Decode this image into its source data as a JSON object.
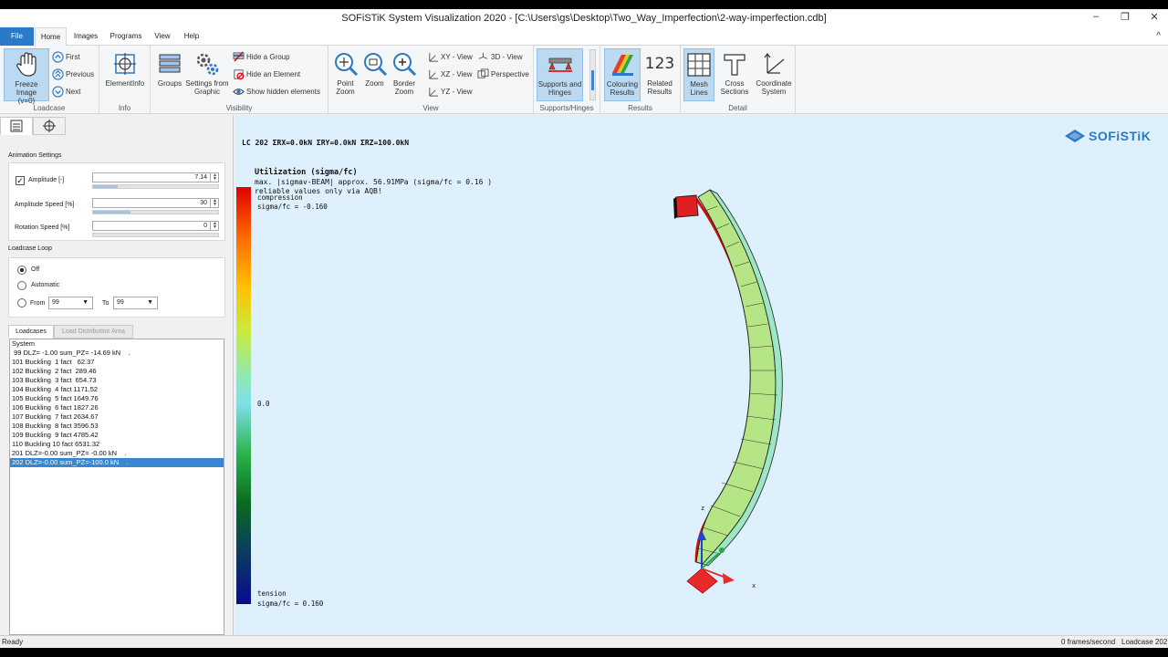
{
  "window": {
    "title": "SOFiSTiK System Visualization 2020 - [C:\\Users\\gs\\Desktop\\Two_Way_Imperfection\\2-way-imperfection.cdb]",
    "min": "–",
    "max": "❐",
    "close": "✕"
  },
  "menu": {
    "file": "File",
    "home": "Home",
    "images": "Images",
    "programs": "Programs",
    "view": "View",
    "help": "Help",
    "collapse": "^"
  },
  "ribbon": {
    "loadcase": {
      "label": "Loadcase",
      "freeze_line1": "Freeze Image",
      "freeze_line2": "(v=0)",
      "first": "First",
      "previous": "Previous",
      "next": "Next"
    },
    "info": {
      "label": "Info",
      "elementinfo": "ElementInfo"
    },
    "visibility": {
      "label": "Visibility",
      "groups": "Groups",
      "settings_line1": "Settings from",
      "settings_line2": "Graphic",
      "hide_group": "Hide a Group",
      "hide_element": "Hide an Element",
      "show_hidden": "Show hidden elements"
    },
    "view": {
      "label": "View",
      "point_zoom_1": "Point",
      "point_zoom_2": "Zoom",
      "zoom": "Zoom",
      "border_zoom_1": "Border",
      "border_zoom_2": "Zoom",
      "xy": "XY - View",
      "xz": "XZ - View",
      "yz": "YZ - View",
      "d3": "3D - View",
      "perspective": "Perspective"
    },
    "supports": {
      "label": "Supports/Hinges",
      "btn_1": "Supports and",
      "btn_2": "Hinges"
    },
    "results": {
      "label": "Results",
      "colouring_1": "Colouring",
      "colouring_2": "Results",
      "related_1": "Related",
      "related_2": "Results",
      "related_icon_text": "123"
    },
    "detail": {
      "label": "Detail",
      "mesh_1": "Mesh",
      "mesh_2": "Lines",
      "cross_1": "Cross",
      "cross_2": "Sections",
      "coord_1": "Coordinate",
      "coord_2": "System"
    }
  },
  "left_panel": {
    "animation_title": "Animation Settings",
    "amplitude_label": "Amplitude [-]",
    "amplitude_value": "7.14",
    "amplitude_fraction": 0.2,
    "amplitude_speed_label": "Amplitude Speed [%]",
    "amplitude_speed_value": "30",
    "amplitude_speed_fraction": 0.3,
    "rotation_speed_label": "Rotation Speed [%]",
    "rotation_speed_value": "0",
    "rotation_speed_fraction": 0,
    "loop_title": "Loadcase Loop",
    "off": "Off",
    "automatic": "Automatic",
    "from": "From",
    "from_value": "99",
    "to": "To",
    "to_value": "99",
    "tab_loadcases": "Loadcases",
    "tab_load_distribution": "Load Distribution Area",
    "loadcases": [
      "System",
      " 99 DLZ= -1.00 sum_PZ= -14.69 kN    .",
      "101 Buckling  1 fact   62.37",
      "102 Buckling  2 fact  289.46",
      "103 Buckling  3 fact  654.73",
      "104 Buckling  4 fact 1171.52",
      "105 Buckling  5 fact 1649.76",
      "106 Buckling  6 fact 1827.26",
      "107 Buckling  7 fact 2634.67",
      "108 Buckling  8 fact 3596.53",
      "109 Buckling  9 fact 4785.42",
      "110 Buckling 10 fact 6531.32",
      "201 DLZ=-0.00 sum_PZ= -0.00 kN    .",
      "202 DLZ=-0.00 sum_PZ=-100.0 kN    ."
    ],
    "selected_index": 13
  },
  "viewport": {
    "lc_header": "LC 202  ΣRX=0.0kN  ΣRY=0.0kN  ΣRZ=100.0kN",
    "util_title": "Utilization (sigma/fc)",
    "util_line2": "max. |sigmav-BEAM| approx. 56.91MPa (sigma/fc = 0.16 )",
    "util_line3": "reliable values only via AQB!",
    "legend_compression": "compression",
    "legend_compression_value": "sigma/fc = -0.160",
    "legend_zero": "0.0",
    "legend_tension": "tension",
    "legend_tension_value": "sigma/fc = 0.160",
    "logo": "SOFiSTiK",
    "axis_z": "z",
    "axis_x": "x",
    "colors": {
      "background": "#ddf0fb",
      "compression": "#e00000",
      "tension": "#0a1580",
      "beam": "#b5e585"
    }
  },
  "status": {
    "left": "Ready",
    "fps": "0 frames/second",
    "loadcase": "Loadcase 202"
  }
}
